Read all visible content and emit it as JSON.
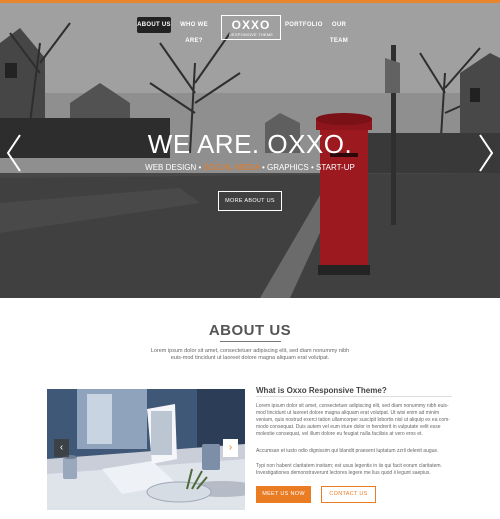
{
  "colors": {
    "accent": "#ea7c24",
    "dark": "#222222",
    "heading": "#555555"
  },
  "nav": {
    "items": [
      {
        "label": "ABOUT US",
        "active": true
      },
      {
        "label": "WHO WE ARE?",
        "active": false
      },
      {
        "label": "PORTFOLIO",
        "active": false
      },
      {
        "label": "OUR TEAM",
        "active": false
      }
    ],
    "logo": {
      "title": "OXXO",
      "subtitle": "RESPONSIVE THEME"
    }
  },
  "hero": {
    "title": "WE ARE. OXXO.",
    "tags": {
      "part1": "WEB DESIGN",
      "sep1": " • ",
      "accent": "SOCIAL MEDIA",
      "sep2": " • ",
      "part3": "GRAPHICS • START-UP"
    },
    "button": "MORE ABOUT US",
    "prev_icon": "chevron-left-icon",
    "next_icon": "chevron-right-icon"
  },
  "about": {
    "title": "ABOUT US",
    "text": "Lorem ipsum dolor sit amet, consectetuer adipiscing elit, sed diam nonummy nibh euis-mod tincidunt ut laoreet dolore magna aliquam erat volutpat."
  },
  "feature": {
    "title": "What is Oxxo Responsive Theme?",
    "p1": "Lorem ipsum dolor sit amet, consectetuer adipiscing elit, sed diam nonummy nibh euis-mod tincidunt ut laoreet dolore magna aliquam erat volutpat. Ut wisi enim ad minim veniam, quis nostrud exerci tation ullamcorper suscipit lobortis nisl ut aliquip ex ea com-modo consequat. Duis autem vel eum iriure dolor in hendrerit in vulputate velit esse molestie consequat, vel illum dolore eu feugiat nulla facilisis at vero eros et.",
    "p2": "Accumsan et iusto odio dignissim qui blandit praesent luptatum zzril delenit augue.",
    "p3": "Typi non habent claritatem insitam; est usus legentis in iis qui facit eorum claritatem. Investigationes demonstraverunt lectores legere me lius quod ii legunt saepius.",
    "meet_button": "MEET US NOW",
    "contact_button": "CONTACT US"
  },
  "slider": {
    "prev_icon": "chevron-left-icon",
    "next_icon": "chevron-right-icon"
  }
}
